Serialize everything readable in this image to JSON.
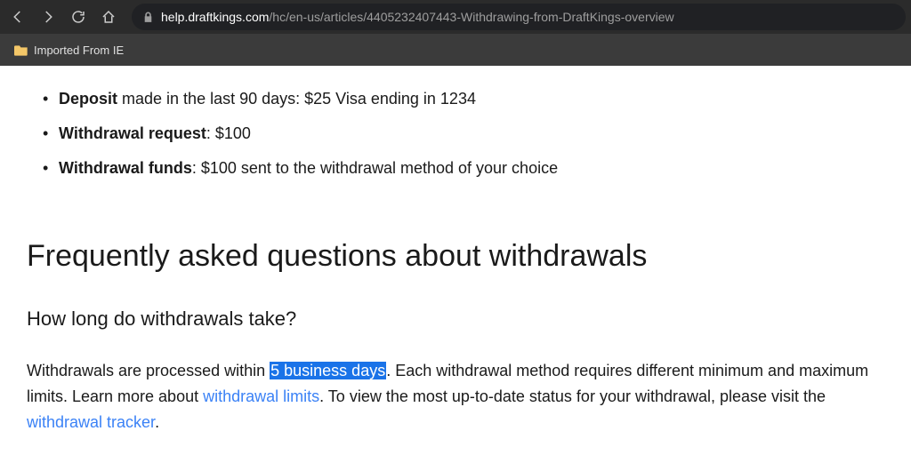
{
  "url": {
    "domain": "help.draftkings.com",
    "path": "/hc/en-us/articles/4405232407443-Withdrawing-from-DraftKings-overview"
  },
  "bookmark_label": "Imported From IE",
  "bullets": [
    {
      "bold": "Deposit",
      "rest": " made in the last 90 days: $25 Visa ending in 1234"
    },
    {
      "bold": "Withdrawal request",
      "rest": ": $100"
    },
    {
      "bold": "Withdrawal funds",
      "rest": ": $100 sent to the withdrawal method of your choice"
    }
  ],
  "heading": "Frequently asked questions about withdrawals",
  "subheading": "How long do withdrawals take?",
  "para": {
    "t1": "Withdrawals are processed within ",
    "highlighted": "5 business days",
    "t2": ". Each withdrawal method requires different minimum and maximum limits. Learn more about ",
    "link1": "withdrawal limits",
    "t3": ". To view the most up-to-date status for your withdrawal, please visit the ",
    "link2": "withdrawal tracker",
    "t4": "."
  }
}
